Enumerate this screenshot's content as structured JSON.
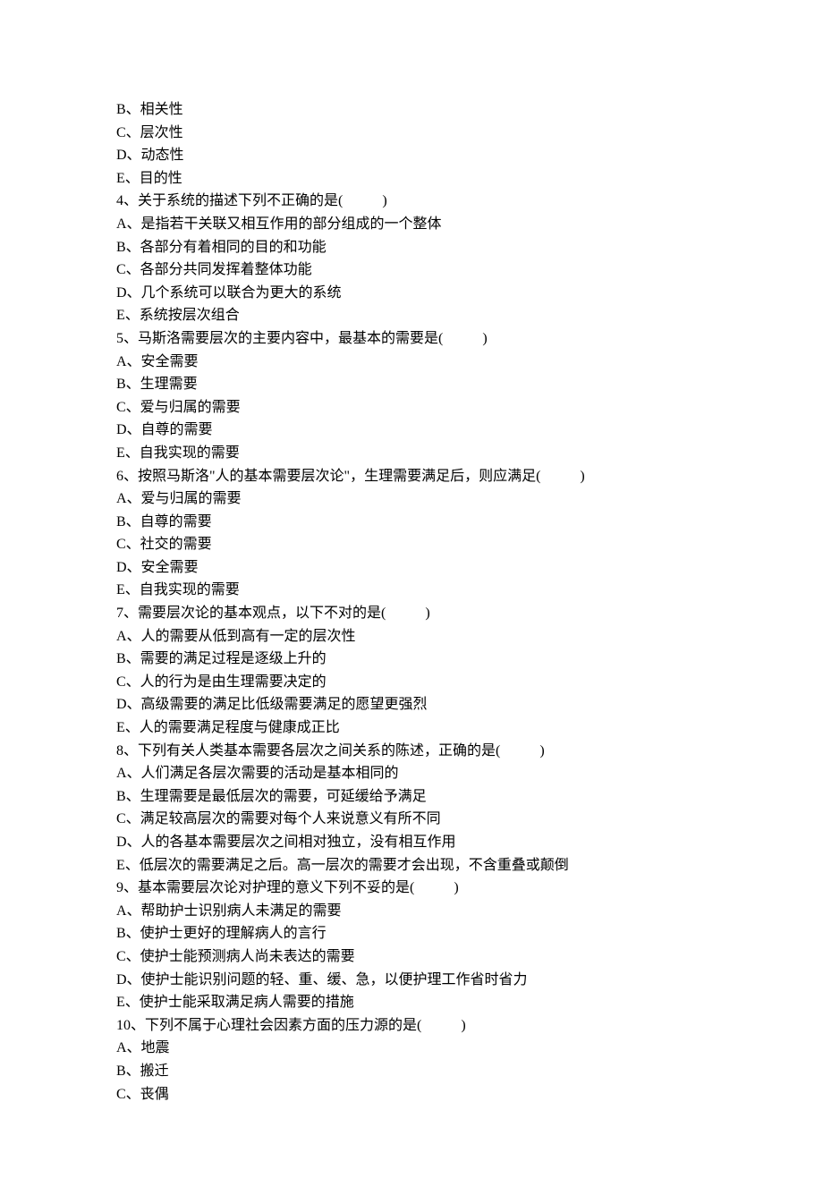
{
  "lines": [
    "B、相关性",
    "C、层次性",
    "D、动态性",
    "E、目的性",
    "4、关于系统的描述下列不正确的是(           )",
    "A、是指若干关联又相互作用的部分组成的一个整体",
    "B、各部分有着相同的目的和功能",
    "C、各部分共同发挥着整体功能",
    "D、几个系统可以联合为更大的系统",
    "E、系统按层次组合",
    "5、马斯洛需要层次的主要内容中，最基本的需要是(           )",
    "A、安全需要",
    "B、生理需要",
    "C、爱与归属的需要",
    "D、自尊的需要",
    "E、自我实现的需要",
    "6、按照马斯洛\"人的基本需要层次论\"，生理需要满足后，则应满足(           )",
    "A、爱与归属的需要",
    "B、自尊的需要",
    "C、社交的需要",
    "D、安全需要",
    "E、自我实现的需要",
    "7、需要层次论的基本观点，以下不对的是(           )",
    "A、人的需要从低到高有一定的层次性",
    "B、需要的满足过程是逐级上升的",
    "C、人的行为是由生理需要决定的",
    "D、高级需要的满足比低级需要满足的愿望更强烈",
    "E、人的需要满足程度与健康成正比",
    "8、下列有关人类基本需要各层次之间关系的陈述，正确的是(           )",
    "A、人们满足各层次需要的活动是基本相同的",
    "B、生理需要是最低层次的需要，可延缓给予满足",
    "C、满足较高层次的需要对每个人来说意义有所不同",
    "D、人的各基本需要层次之间相对独立，没有相互作用",
    "E、低层次的需要满足之后。高一层次的需要才会出现，不含重叠或颠倒",
    "9、基本需要层次论对护理的意义下列不妥的是(           )",
    "A、帮助护士识别病人未满足的需要",
    "B、使护士更好的理解病人的言行",
    "C、使护士能预测病人尚未表达的需要",
    "D、使护士能识别问题的轻、重、缓、急，以便护理工作省时省力",
    "E、使护士能采取满足病人需要的措施",
    "10、下列不属于心理社会因素方面的压力源的是(           )",
    "A、地震",
    "B、搬迁",
    "C、丧偶"
  ]
}
